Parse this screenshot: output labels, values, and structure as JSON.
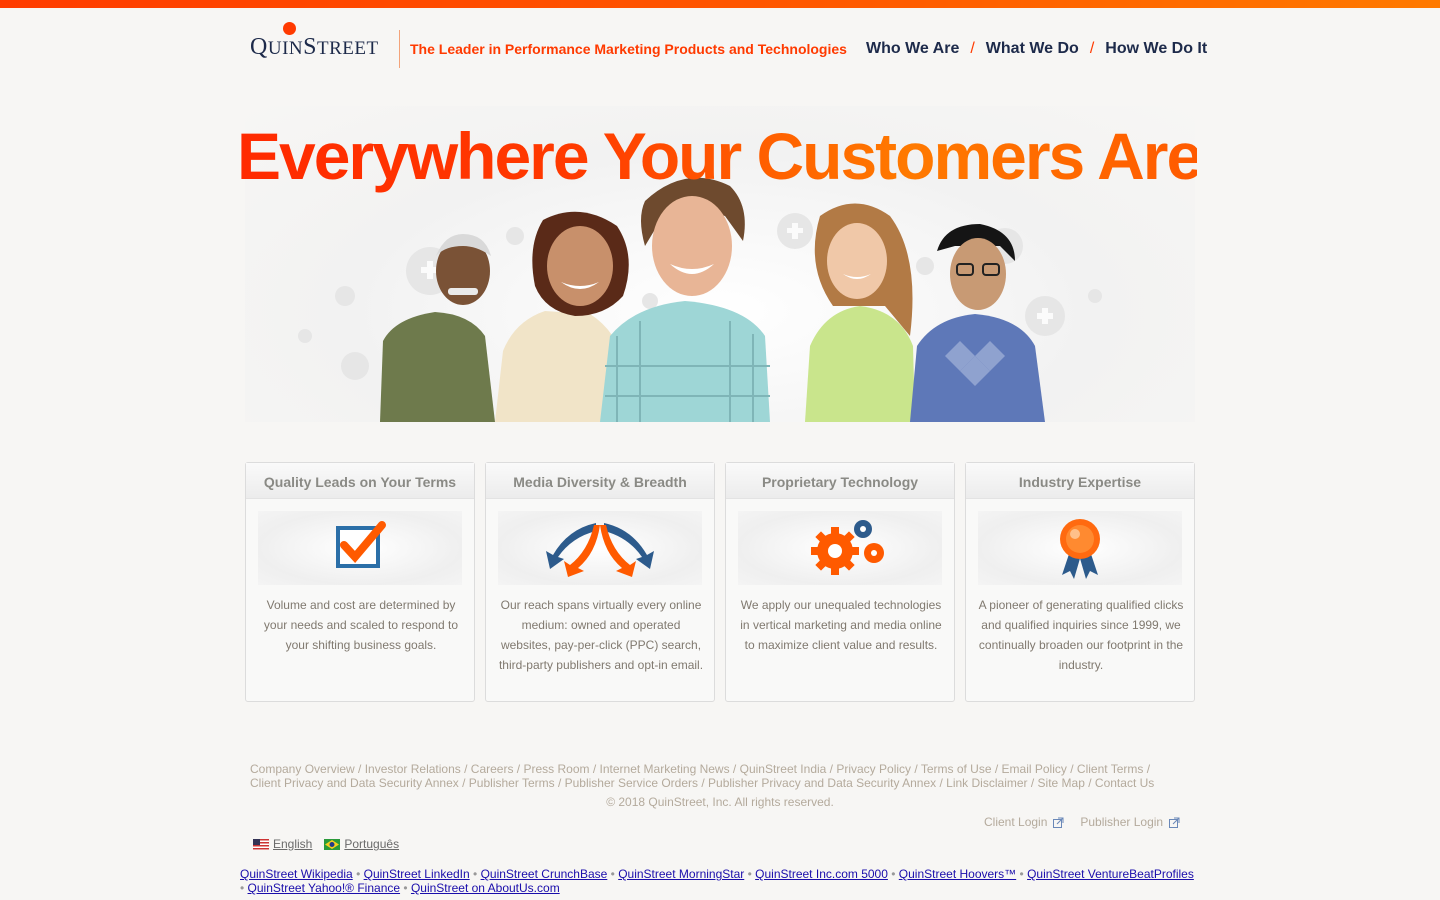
{
  "header": {
    "logo_text_big": "Q",
    "logo_text_small": "UIN",
    "logo_text_big2": "S",
    "logo_text_small2": "TREET",
    "tagline": "The Leader in Performance Marketing Products and Technologies",
    "nav": [
      "Who We Are",
      "What We Do",
      "How We Do It"
    ],
    "nav_separator": "/"
  },
  "hero": {
    "title": "Everywhere Your Customers Are"
  },
  "cards": [
    {
      "title": "Quality Leads on Your Terms",
      "icon": "checkbox-check-icon",
      "desc": "Volume and cost are determined by your needs and scaled to respond to your shifting business goals."
    },
    {
      "title": "Media Diversity & Breadth",
      "icon": "diverging-arrows-icon",
      "desc": "Our reach spans virtually every online medium: owned and operated websites, pay-per-click (PPC) search, third-party publishers and opt-in email."
    },
    {
      "title": "Proprietary Technology",
      "icon": "gears-icon",
      "desc": "We apply our unequaled technologies in vertical marketing and media online to maximize client value and results."
    },
    {
      "title": "Industry Expertise",
      "icon": "award-ribbon-icon",
      "desc": "A pioneer of generating qualified clicks and qualified inquiries since 1999, we continually broaden our footprint in the industry."
    }
  ],
  "footer": {
    "links": [
      "Company Overview",
      "Investor Relations",
      "Careers",
      "Press Room",
      "Internet Marketing News",
      "QuinStreet India",
      "Privacy Policy",
      "Terms of Use",
      "Email Policy",
      "Client Terms",
      "Client Privacy and Data Security Annex",
      "Publisher Terms",
      "Publisher Service Orders",
      "Publisher Privacy and Data Security Annex",
      "Link Disclaimer",
      "Site Map",
      "Contact Us"
    ],
    "copyright": "© 2018 QuinStreet, Inc. All rights reserved.",
    "client_login": "Client Login",
    "publisher_login": "Publisher Login"
  },
  "languages": [
    "English",
    "Português"
  ],
  "external_links": [
    "QuinStreet Wikipedia",
    "QuinStreet LinkedIn",
    "QuinStreet CrunchBase",
    "QuinStreet MorningStar",
    "QuinStreet Inc.com 5000",
    "QuinStreet Hoovers™",
    "QuinStreet VentureBeatProfiles",
    "QuinStreet Yahoo!® Finance",
    "QuinStreet on AboutUs.com"
  ],
  "colors": {
    "accent": "#ff3a00",
    "navy": "#1d2a4a",
    "footer_text": "#b4aa9c"
  }
}
